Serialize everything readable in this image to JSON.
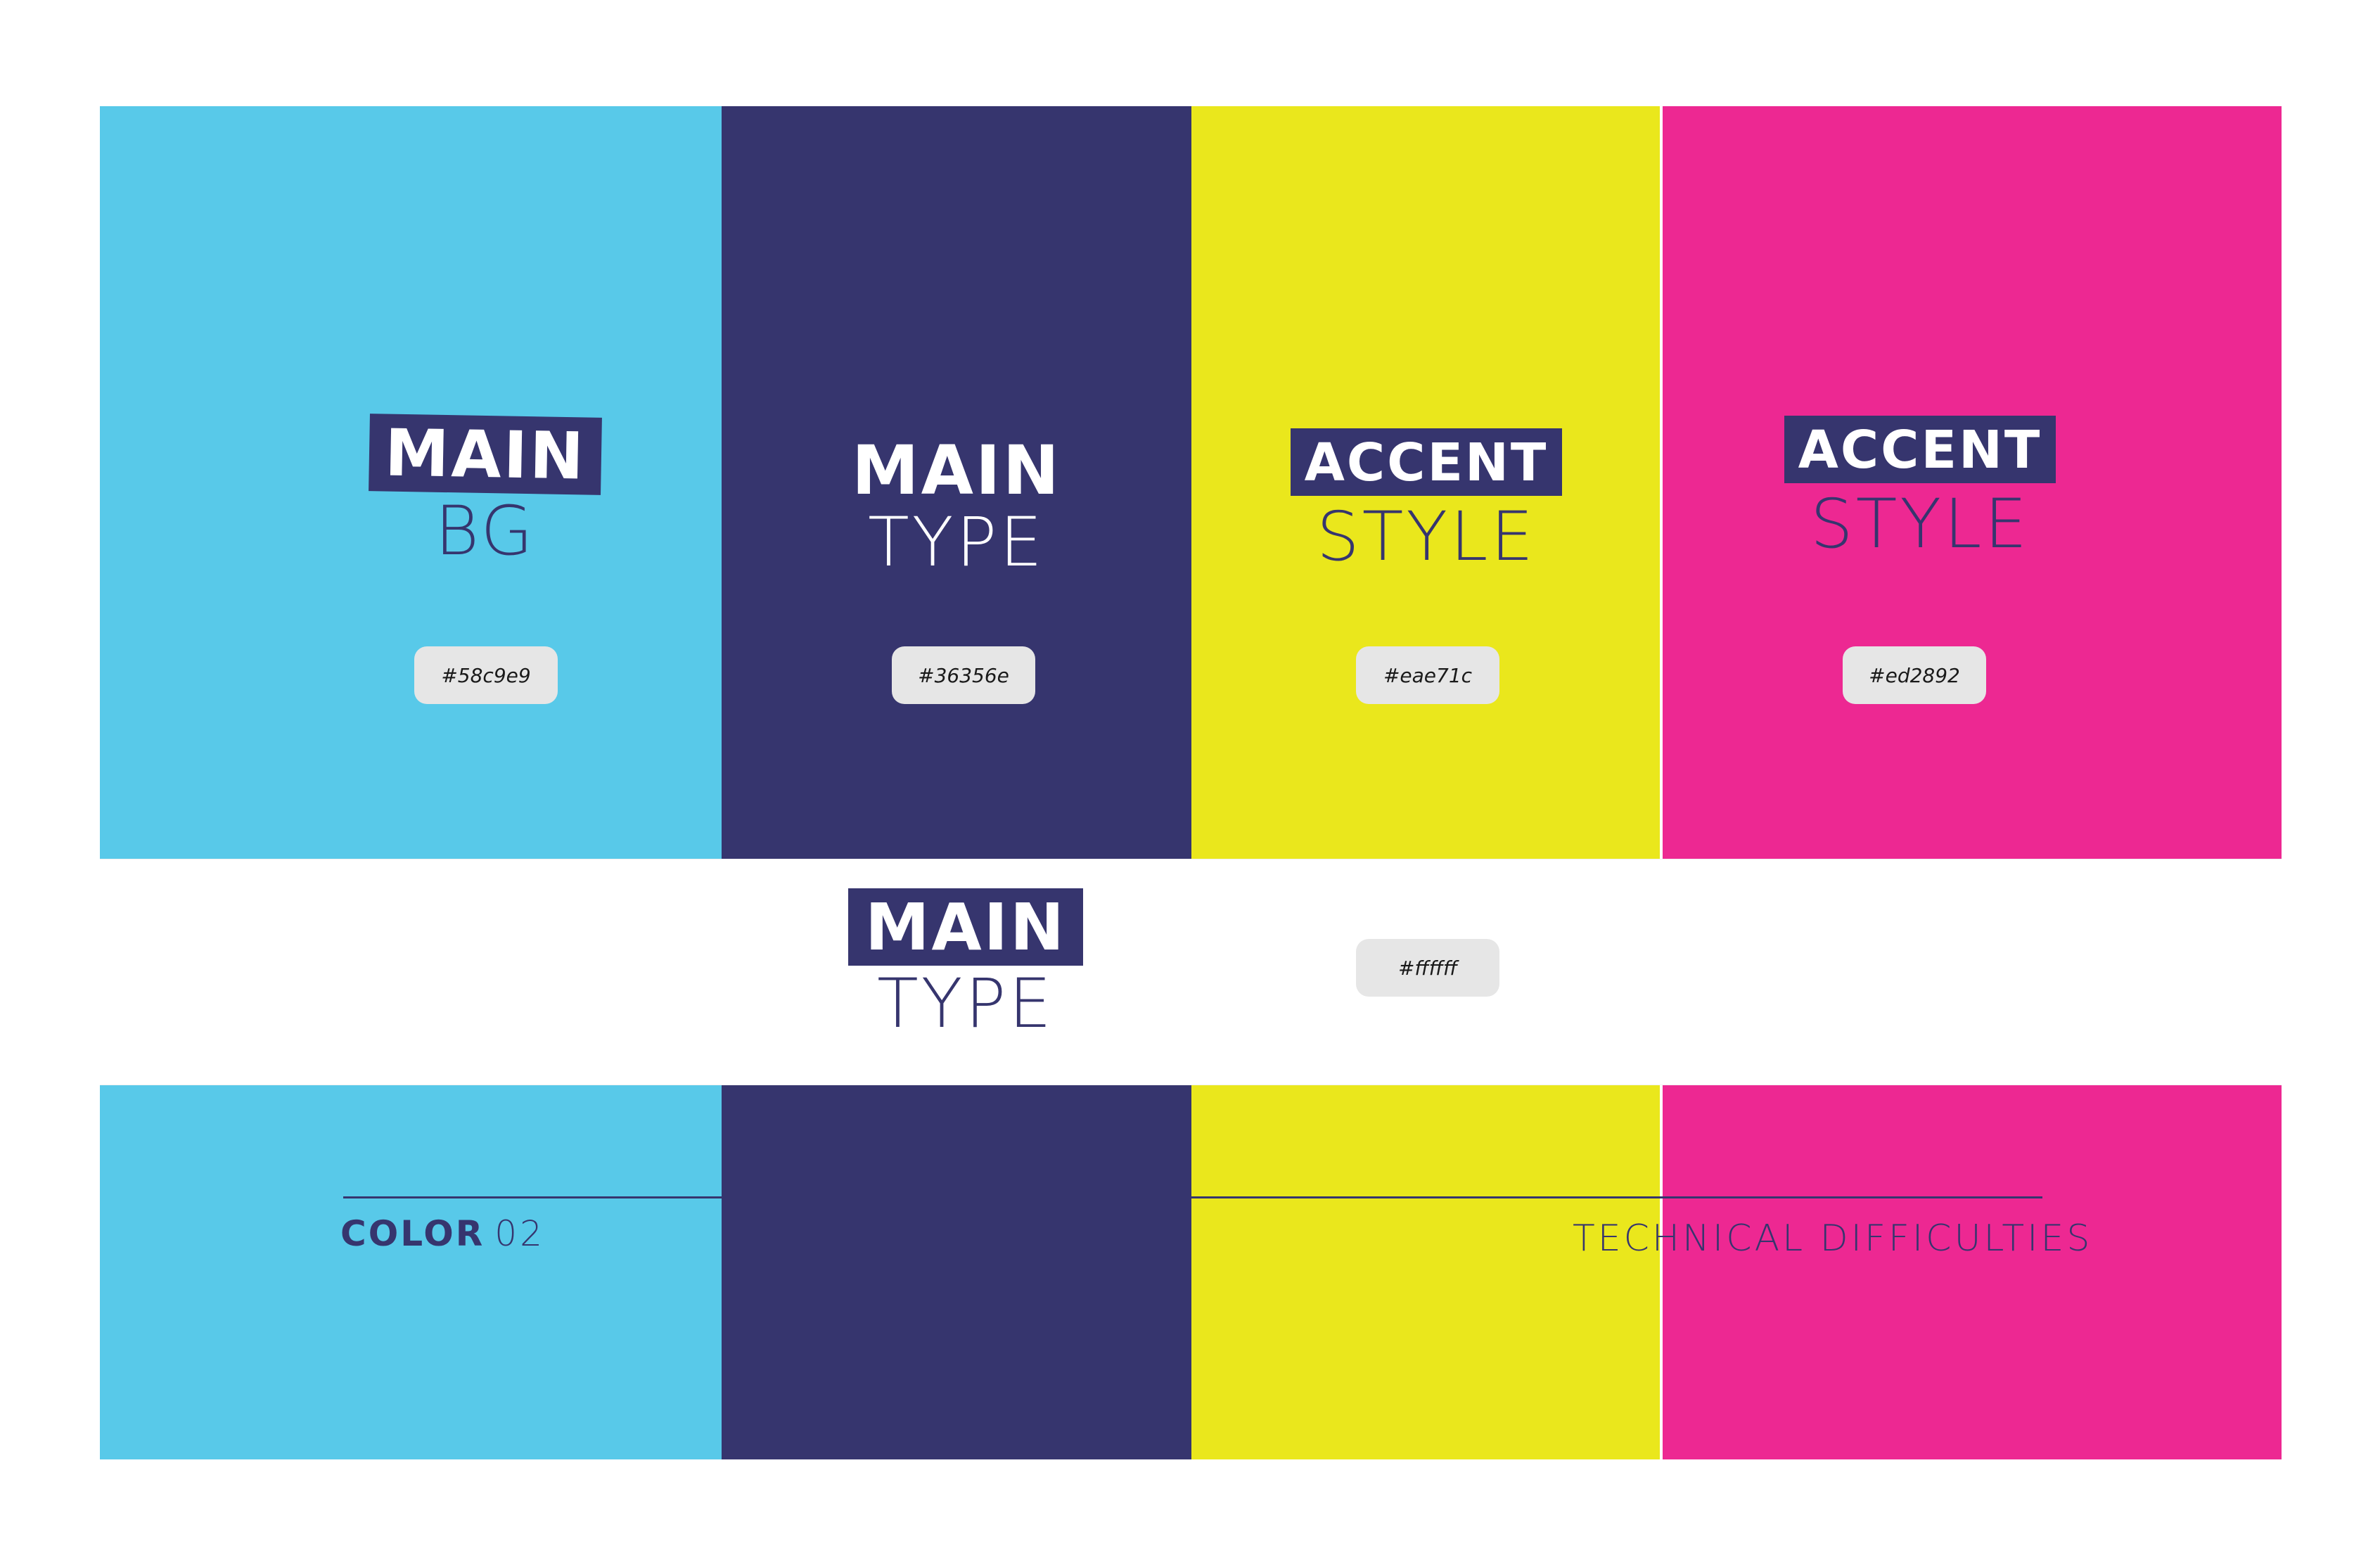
{
  "colors": {
    "main_bg": "#58c9e9",
    "main_type": "#36356e",
    "accent_1": "#eae71c",
    "accent_2": "#ed2892",
    "white": "#ffffff",
    "swatch_bg": "#e6e6e6"
  },
  "cards": [
    {
      "title": "MAIN",
      "subtitle": "BG",
      "hex": "#58c9e9"
    },
    {
      "title": "MAIN",
      "subtitle": "TYPE",
      "hex": "#36356e"
    },
    {
      "title": "ACCENT",
      "subtitle": "STYLE",
      "hex": "#eae71c"
    },
    {
      "title": "ACCENT",
      "subtitle": "STYLE",
      "hex": "#ed2892"
    }
  ],
  "white_band": {
    "title": "MAIN",
    "subtitle": "TYPE",
    "hex": "#ffffff"
  },
  "footer": {
    "left_strong": "COLOR",
    "left_light": "02",
    "right": "TECHNICAL DIFFICULTIES"
  }
}
